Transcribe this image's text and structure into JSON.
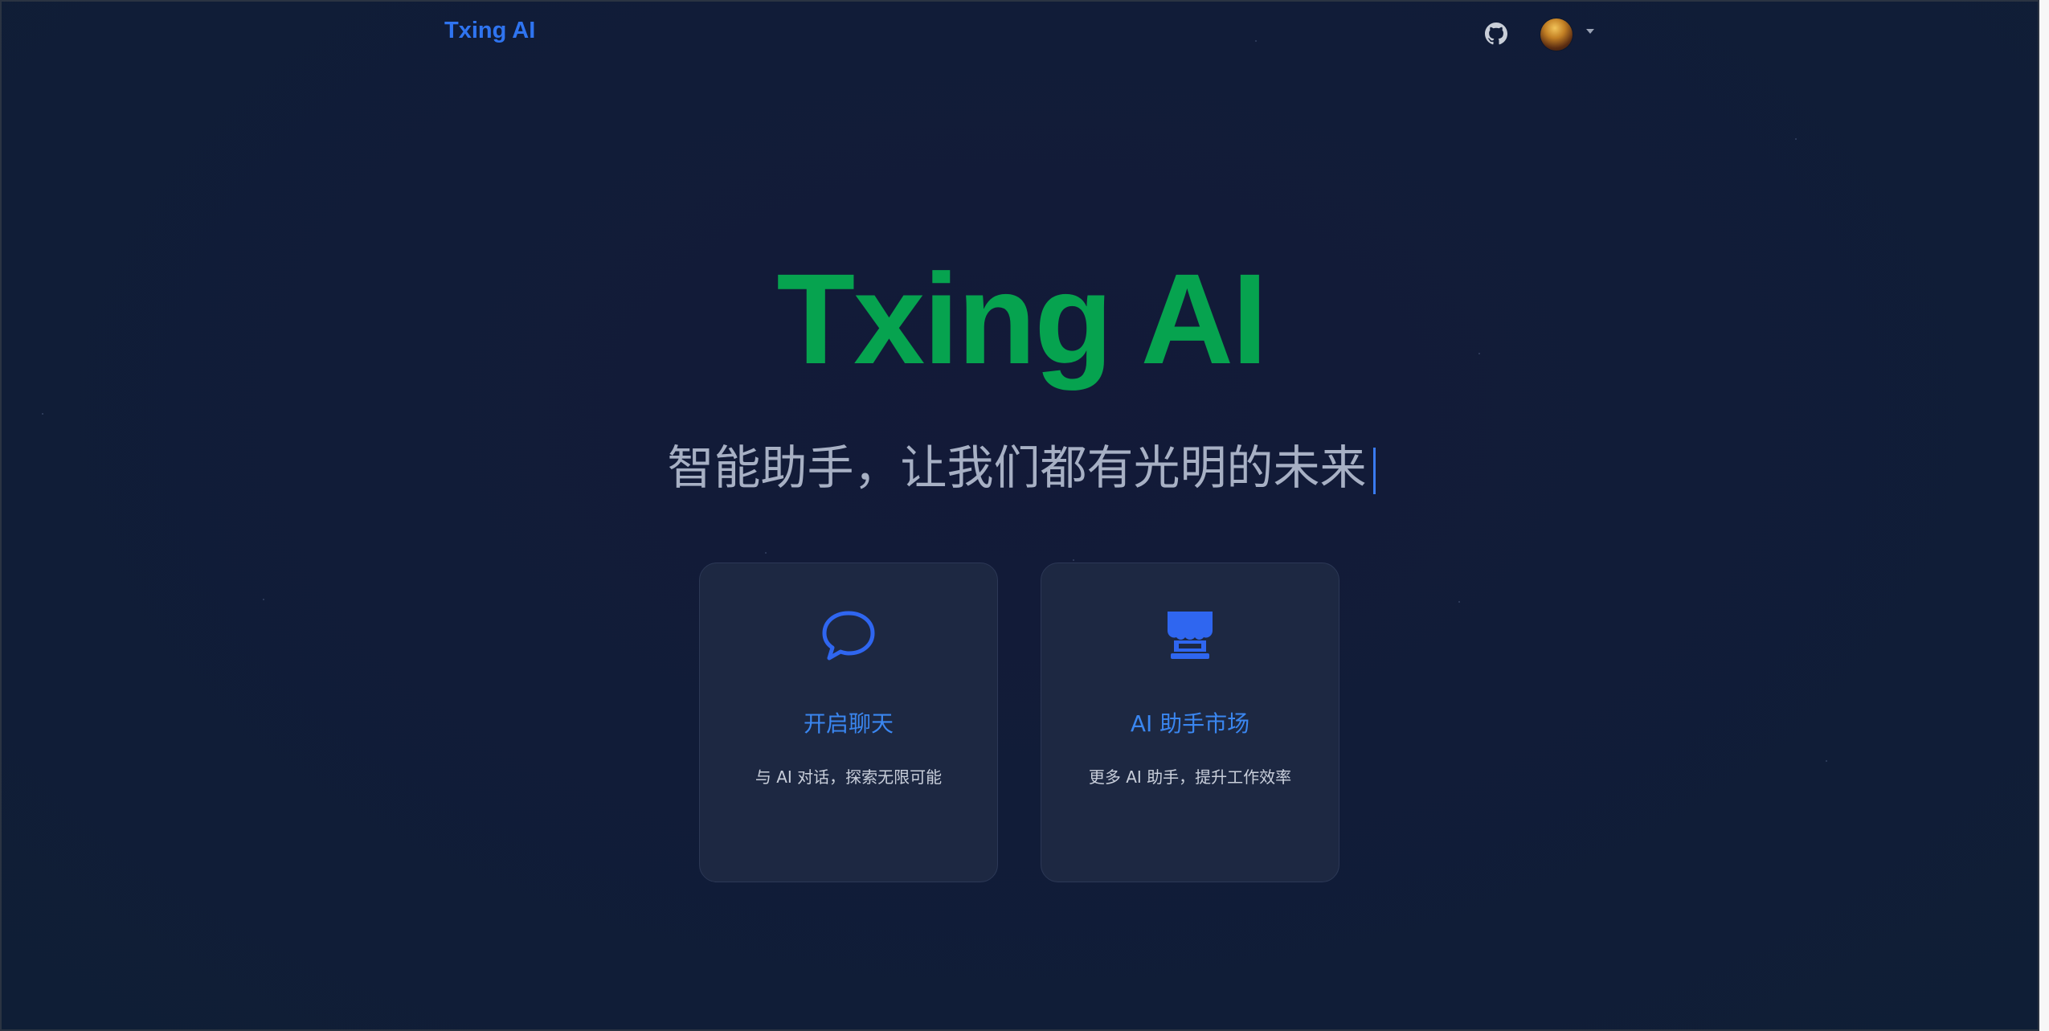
{
  "header": {
    "logo": "Txing AI",
    "github_icon": "github-icon",
    "avatar_icon": "user-avatar",
    "menu_icon": "caret-down-icon"
  },
  "hero": {
    "title": "Txing AI",
    "subtitle": "智能助手，让我们都有光明的未来"
  },
  "cards": [
    {
      "icon": "chat-bubble-icon",
      "title": "开启聊天",
      "description": "与 AI 对话，探索无限可能"
    },
    {
      "icon": "store-icon",
      "title": "AI 助手市场",
      "description": "更多 AI 助手，提升工作效率"
    }
  ],
  "colors": {
    "background": "#111c38",
    "brand_blue": "#2f74f0",
    "hero_green": "#06a34f",
    "card_bg": "#1d2842"
  }
}
